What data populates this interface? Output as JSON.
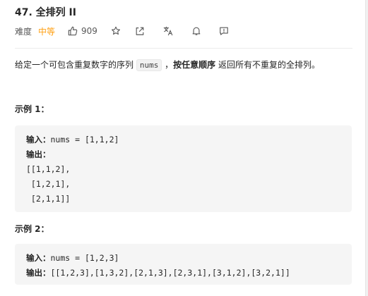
{
  "problem": {
    "title": "47. 全排列 II",
    "difficulty_label": "难度",
    "difficulty": "中等",
    "likes": "909",
    "difficulty_color": "#ffa116"
  },
  "icons": [
    "thumbs-up-icon",
    "star-icon",
    "share-icon",
    "translate-icon",
    "bell-icon",
    "feedback-icon"
  ],
  "description": {
    "part1": "给定一个可包含重复数字的序列 ",
    "code": "nums",
    "part2": " ，",
    "bold": "按任意顺序",
    "part3": " 返回所有不重复的全排列。"
  },
  "examples": [
    {
      "title": "示例 1：",
      "input_label": "输入：",
      "input_value": "nums = [1,1,2]",
      "output_label": "输出：",
      "output_lines": [
        "[[1,1,2],",
        " [1,2,1],",
        " [2,1,1]]"
      ]
    },
    {
      "title": "示例 2：",
      "input_label": "输入：",
      "input_value": "nums = [1,2,3]",
      "output_label": "输出：",
      "output_value": "[[1,2,3],[1,3,2],[2,1,3],[2,3,1],[3,1,2],[3,2,1]]"
    }
  ]
}
